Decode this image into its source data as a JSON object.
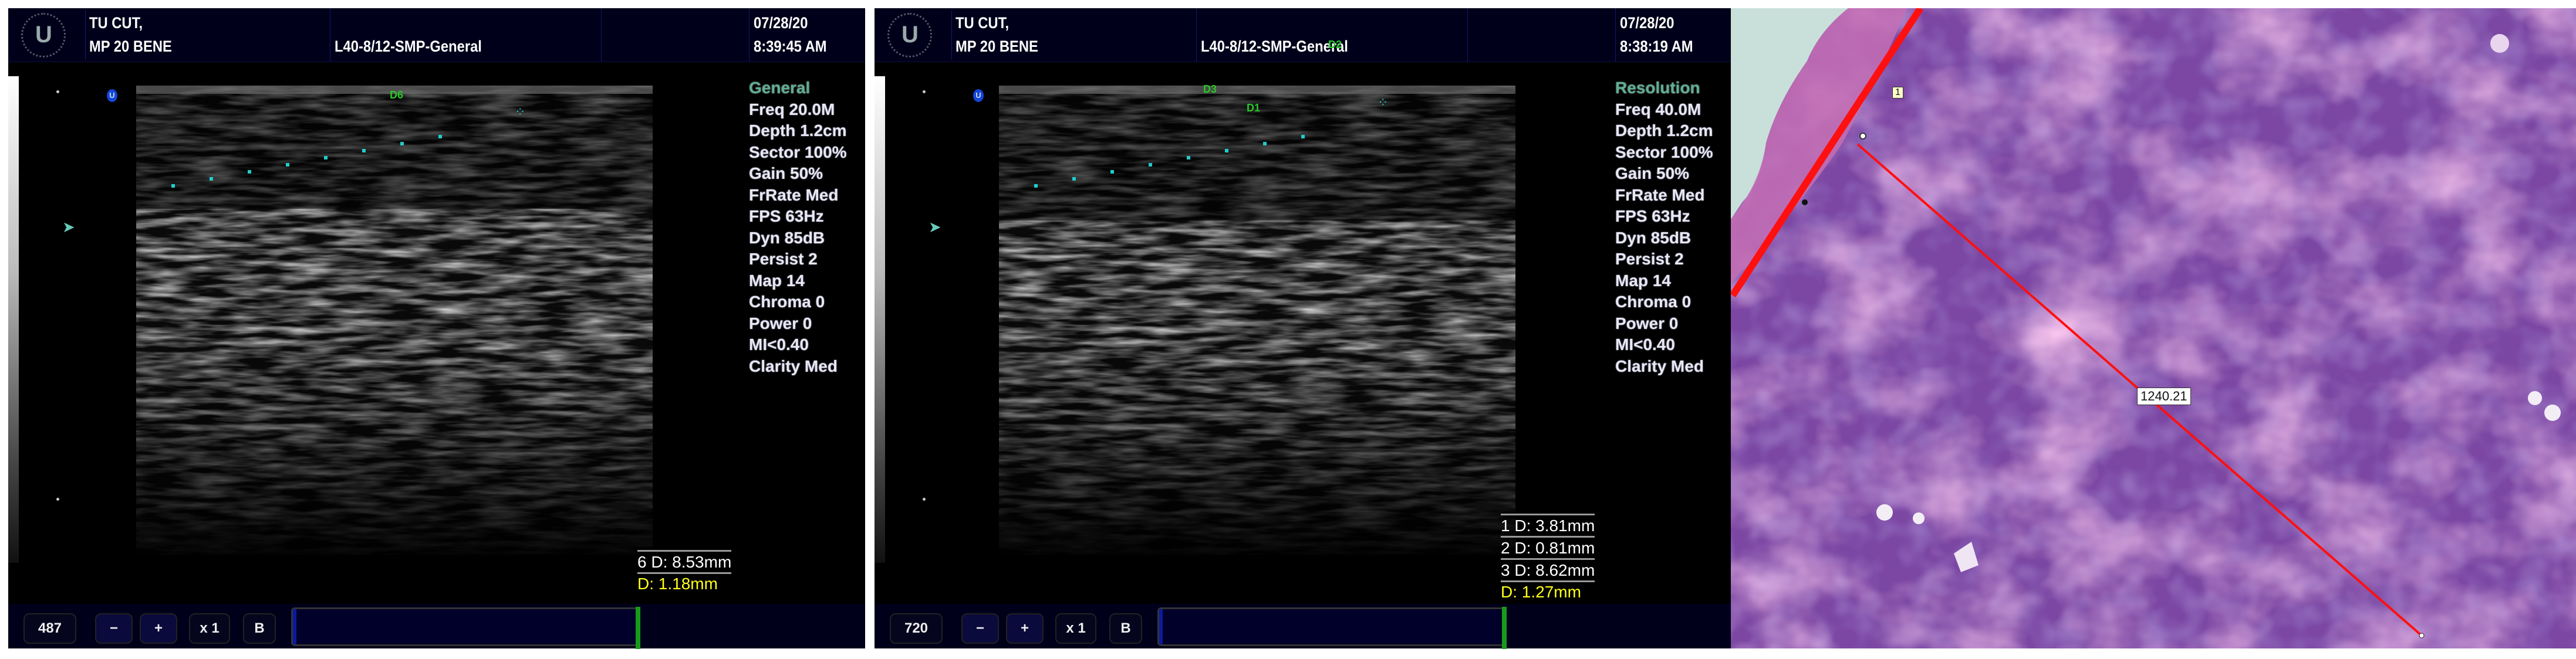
{
  "panels": [
    {
      "patient_line1": "TU CUT,",
      "patient_line2": "MP 20 BENE",
      "preset": "L40-8/12-SMP-General",
      "date": "07/28/20",
      "time": "8:39:45 AM",
      "logo_letter": "U",
      "params": [
        "General",
        "Freq 20.0M",
        "Depth 1.2cm",
        "Sector 100%",
        "Gain 50%",
        "FrRate Med",
        "FPS 63Hz",
        "Dyn 85dB",
        "Persist 2",
        "Map 14",
        "Chroma 0",
        "Power 0",
        "MI<0.40",
        "Clarity Med"
      ],
      "measurements": [
        "6 D: 8.53mm"
      ],
      "current_measurement": "D: 1.18mm",
      "markers": [
        "D6"
      ],
      "toolbar": {
        "frame": "487",
        "minus": "−",
        "plus": "+",
        "zoom": "x 1",
        "mode": "B"
      }
    },
    {
      "patient_line1": "TU CUT,",
      "patient_line2": "MP 20 BENE",
      "preset": "L40-8/12-SMP-General",
      "date": "07/28/20",
      "time": "8:38:19 AM",
      "logo_letter": "U",
      "params": [
        "Resolution",
        "Freq 40.0M",
        "Depth 1.2cm",
        "Sector 100%",
        "Gain 50%",
        "FrRate Med",
        "FPS 63Hz",
        "Dyn 85dB",
        "Persist 2",
        "Map 14",
        "Chroma 0",
        "Power 0",
        "MI<0.40",
        "Clarity Med"
      ],
      "measurements": [
        "1 D: 3.81mm",
        "2 D: 0.81mm",
        "3 D: 8.62mm"
      ],
      "current_measurement": "D: 1.27mm",
      "markers": [
        "D2",
        "D3",
        "D1"
      ],
      "toolbar": {
        "frame": "720",
        "minus": "−",
        "plus": "+",
        "zoom": "x 1",
        "mode": "B"
      }
    }
  ],
  "histology": {
    "line_label": "1",
    "measurement": "1240.21",
    "line_color": "#ff1010"
  }
}
